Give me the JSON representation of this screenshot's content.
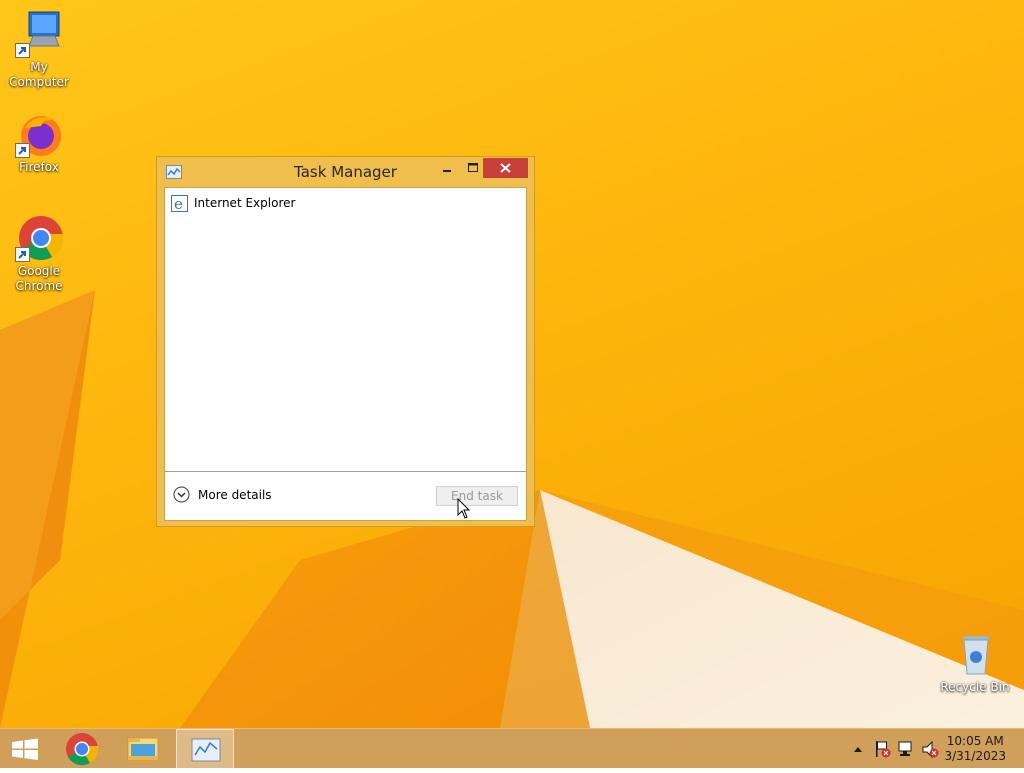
{
  "desktop_icons": [
    {
      "label": "My Computer",
      "icon": "computer-icon"
    },
    {
      "label": "Firefox",
      "icon": "firefox-icon"
    },
    {
      "label": "Google Chrome",
      "icon": "chrome-icon"
    },
    {
      "label": "Recycle Bin",
      "icon": "recycle-bin-icon"
    }
  ],
  "task_manager": {
    "title": "Task Manager",
    "processes": [
      {
        "name": "Internet Explorer",
        "icon": "internet-explorer-icon"
      }
    ],
    "more_details_label": "More details",
    "end_task_label": "End task",
    "end_task_enabled": false
  },
  "taskbar": {
    "items": [
      {
        "name": "start-button",
        "icon": "windows-icon"
      },
      {
        "name": "Google Chrome",
        "icon": "chrome-icon"
      },
      {
        "name": "File Explorer",
        "icon": "folder-icon"
      },
      {
        "name": "Task Manager",
        "icon": "task-manager-icon",
        "active": true
      }
    ],
    "tray_icons": [
      "show-hidden-icons",
      "action-center-flag-icon",
      "network-icon",
      "volume-muted-icon"
    ],
    "time": "10:05 AM",
    "date": "3/31/2023"
  },
  "colors": {
    "wallpaper": "#fdb50c",
    "window_frame": "#f0be4c",
    "close_button": "#c7403a",
    "taskbar": "#d0a05a"
  }
}
